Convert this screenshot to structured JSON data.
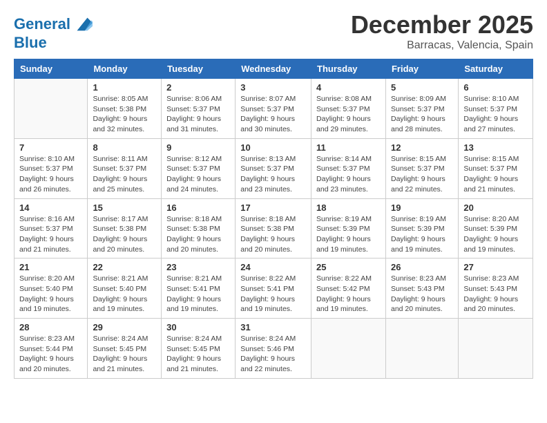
{
  "header": {
    "logo_line1": "General",
    "logo_line2": "Blue",
    "month": "December 2025",
    "location": "Barracas, Valencia, Spain"
  },
  "weekdays": [
    "Sunday",
    "Monday",
    "Tuesday",
    "Wednesday",
    "Thursday",
    "Friday",
    "Saturday"
  ],
  "weeks": [
    [
      {
        "day": "",
        "info": ""
      },
      {
        "day": "1",
        "info": "Sunrise: 8:05 AM\nSunset: 5:38 PM\nDaylight: 9 hours\nand 32 minutes."
      },
      {
        "day": "2",
        "info": "Sunrise: 8:06 AM\nSunset: 5:37 PM\nDaylight: 9 hours\nand 31 minutes."
      },
      {
        "day": "3",
        "info": "Sunrise: 8:07 AM\nSunset: 5:37 PM\nDaylight: 9 hours\nand 30 minutes."
      },
      {
        "day": "4",
        "info": "Sunrise: 8:08 AM\nSunset: 5:37 PM\nDaylight: 9 hours\nand 29 minutes."
      },
      {
        "day": "5",
        "info": "Sunrise: 8:09 AM\nSunset: 5:37 PM\nDaylight: 9 hours\nand 28 minutes."
      },
      {
        "day": "6",
        "info": "Sunrise: 8:10 AM\nSunset: 5:37 PM\nDaylight: 9 hours\nand 27 minutes."
      }
    ],
    [
      {
        "day": "7",
        "info": "Sunrise: 8:10 AM\nSunset: 5:37 PM\nDaylight: 9 hours\nand 26 minutes."
      },
      {
        "day": "8",
        "info": "Sunrise: 8:11 AM\nSunset: 5:37 PM\nDaylight: 9 hours\nand 25 minutes."
      },
      {
        "day": "9",
        "info": "Sunrise: 8:12 AM\nSunset: 5:37 PM\nDaylight: 9 hours\nand 24 minutes."
      },
      {
        "day": "10",
        "info": "Sunrise: 8:13 AM\nSunset: 5:37 PM\nDaylight: 9 hours\nand 23 minutes."
      },
      {
        "day": "11",
        "info": "Sunrise: 8:14 AM\nSunset: 5:37 PM\nDaylight: 9 hours\nand 23 minutes."
      },
      {
        "day": "12",
        "info": "Sunrise: 8:15 AM\nSunset: 5:37 PM\nDaylight: 9 hours\nand 22 minutes."
      },
      {
        "day": "13",
        "info": "Sunrise: 8:15 AM\nSunset: 5:37 PM\nDaylight: 9 hours\nand 21 minutes."
      }
    ],
    [
      {
        "day": "14",
        "info": "Sunrise: 8:16 AM\nSunset: 5:37 PM\nDaylight: 9 hours\nand 21 minutes."
      },
      {
        "day": "15",
        "info": "Sunrise: 8:17 AM\nSunset: 5:38 PM\nDaylight: 9 hours\nand 20 minutes."
      },
      {
        "day": "16",
        "info": "Sunrise: 8:18 AM\nSunset: 5:38 PM\nDaylight: 9 hours\nand 20 minutes."
      },
      {
        "day": "17",
        "info": "Sunrise: 8:18 AM\nSunset: 5:38 PM\nDaylight: 9 hours\nand 20 minutes."
      },
      {
        "day": "18",
        "info": "Sunrise: 8:19 AM\nSunset: 5:39 PM\nDaylight: 9 hours\nand 19 minutes."
      },
      {
        "day": "19",
        "info": "Sunrise: 8:19 AM\nSunset: 5:39 PM\nDaylight: 9 hours\nand 19 minutes."
      },
      {
        "day": "20",
        "info": "Sunrise: 8:20 AM\nSunset: 5:39 PM\nDaylight: 9 hours\nand 19 minutes."
      }
    ],
    [
      {
        "day": "21",
        "info": "Sunrise: 8:20 AM\nSunset: 5:40 PM\nDaylight: 9 hours\nand 19 minutes."
      },
      {
        "day": "22",
        "info": "Sunrise: 8:21 AM\nSunset: 5:40 PM\nDaylight: 9 hours\nand 19 minutes."
      },
      {
        "day": "23",
        "info": "Sunrise: 8:21 AM\nSunset: 5:41 PM\nDaylight: 9 hours\nand 19 minutes."
      },
      {
        "day": "24",
        "info": "Sunrise: 8:22 AM\nSunset: 5:41 PM\nDaylight: 9 hours\nand 19 minutes."
      },
      {
        "day": "25",
        "info": "Sunrise: 8:22 AM\nSunset: 5:42 PM\nDaylight: 9 hours\nand 19 minutes."
      },
      {
        "day": "26",
        "info": "Sunrise: 8:23 AM\nSunset: 5:43 PM\nDaylight: 9 hours\nand 20 minutes."
      },
      {
        "day": "27",
        "info": "Sunrise: 8:23 AM\nSunset: 5:43 PM\nDaylight: 9 hours\nand 20 minutes."
      }
    ],
    [
      {
        "day": "28",
        "info": "Sunrise: 8:23 AM\nSunset: 5:44 PM\nDaylight: 9 hours\nand 20 minutes."
      },
      {
        "day": "29",
        "info": "Sunrise: 8:24 AM\nSunset: 5:45 PM\nDaylight: 9 hours\nand 21 minutes."
      },
      {
        "day": "30",
        "info": "Sunrise: 8:24 AM\nSunset: 5:45 PM\nDaylight: 9 hours\nand 21 minutes."
      },
      {
        "day": "31",
        "info": "Sunrise: 8:24 AM\nSunset: 5:46 PM\nDaylight: 9 hours\nand 22 minutes."
      },
      {
        "day": "",
        "info": ""
      },
      {
        "day": "",
        "info": ""
      },
      {
        "day": "",
        "info": ""
      }
    ]
  ]
}
